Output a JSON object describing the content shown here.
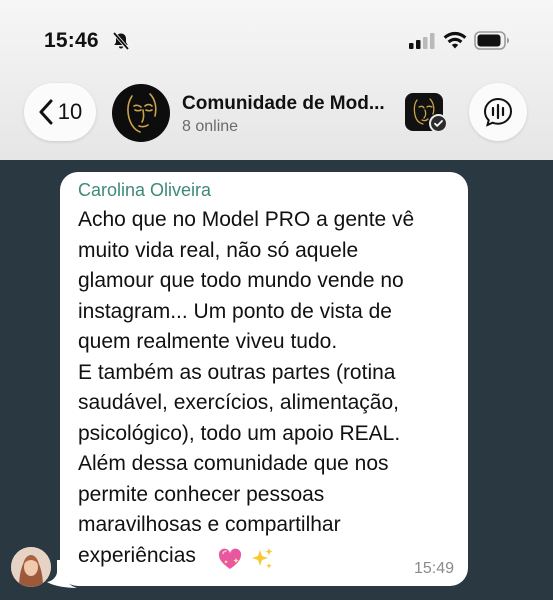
{
  "status_bar": {
    "time": "15:46",
    "icons": [
      "bell-slash-icon",
      "cellular-signal-icon",
      "wifi-icon",
      "battery-icon"
    ]
  },
  "header": {
    "back_count": "10",
    "group_name": "Comunidade de Mod...",
    "online_status": "8 online",
    "avatar_icon": "face-line-art-logo",
    "app_icon": "verified-app-icon",
    "voice_icon": "voice-chat-icon"
  },
  "message": {
    "sender": "Carolina Oliveira",
    "text": "Acho que no Model PRO a gente vê\nmuito vida real, não só  aquele\nglamour que todo mundo vende no\ninstagram... Um ponto de vista de\nquem realmente viveu tudo.\nE também as outras partes (rotina\nsaudável, exercícios, alimentação,\npsicológico), todo um apoio REAL.\nAlém dessa comunidade que nos\npermite conhecer pessoas\nmaravilhosas e compartilhar\nexperiências",
    "emojis": [
      "sparkling-heart-icon",
      "sparkles-icon"
    ],
    "time": "15:49"
  },
  "colors": {
    "chat_background": "#293841",
    "sender_name": "#3d8a78",
    "bubble": "#ffffff",
    "header_background": "#ececec"
  }
}
